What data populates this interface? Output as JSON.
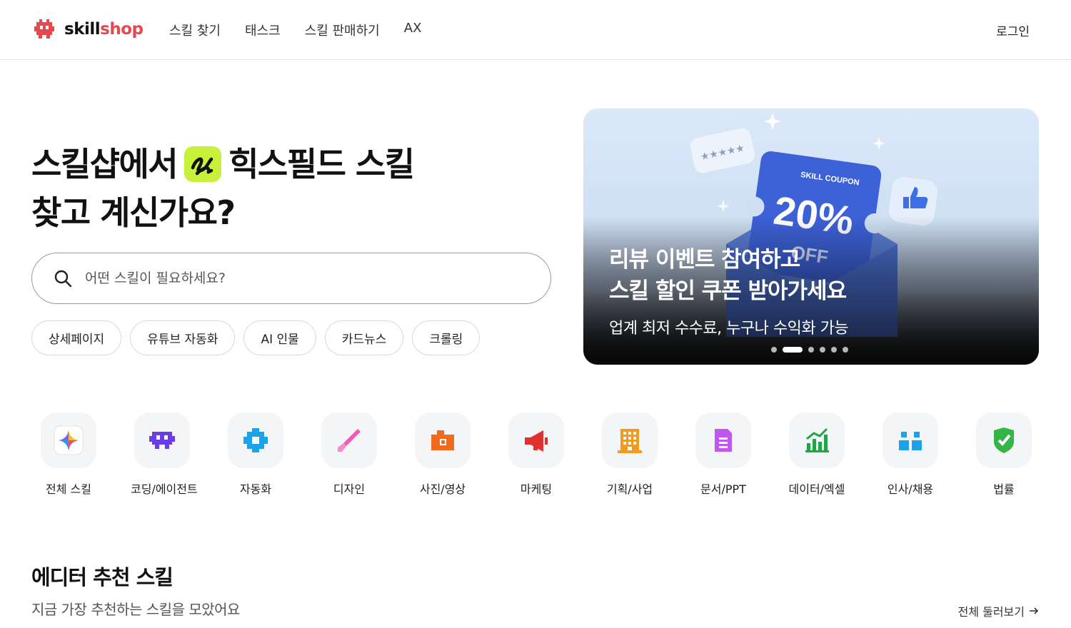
{
  "header": {
    "logo_skill": "skill",
    "logo_shop": "shop",
    "nav": [
      "스킬 찾기",
      "태스크",
      "스킬 판매하기",
      "AX"
    ],
    "login": "로그인"
  },
  "hero": {
    "title_part1": "스킬샵에서",
    "title_part2": "힉스필드 스킬",
    "title_line2": "찾고 계신가요?",
    "search_placeholder": "어떤 스킬이 필요하세요?",
    "chips": [
      "상세페이지",
      "유튜브 자동화",
      "AI 인물",
      "카드뉴스",
      "크롤링"
    ]
  },
  "banner": {
    "coupon_label": "SKILL COUPON",
    "coupon_value": "20%",
    "coupon_off": "OFF",
    "headline_line1": "리뷰 이벤트 참여하고",
    "headline_line2": "스킬 할인 쿠폰 받아가세요",
    "subtext": "업계 최저 수수료, 누구나 수익화 가능",
    "slide_count": 6,
    "active_slide": 2
  },
  "categories": [
    {
      "label": "전체 스킬",
      "icon": "sparkle-icon",
      "color": "#7b61ff"
    },
    {
      "label": "코딩/에이전트",
      "icon": "robot-icon",
      "color": "#6a3de8"
    },
    {
      "label": "자동화",
      "icon": "gear-icon",
      "color": "#1aa3e8"
    },
    {
      "label": "디자인",
      "icon": "brush-icon",
      "color": "#f05bb5"
    },
    {
      "label": "사진/영상",
      "icon": "camera-icon",
      "color": "#f26b1d"
    },
    {
      "label": "마케팅",
      "icon": "megaphone-icon",
      "color": "#e0312f"
    },
    {
      "label": "기획/사업",
      "icon": "building-icon",
      "color": "#f29a1d"
    },
    {
      "label": "문서/PPT",
      "icon": "document-icon",
      "color": "#c257f0"
    },
    {
      "label": "데이터/엑셀",
      "icon": "bar-chart-icon",
      "color": "#22a447"
    },
    {
      "label": "인사/채용",
      "icon": "people-icon",
      "color": "#1aa3e8"
    },
    {
      "label": "법률",
      "icon": "shield-check-icon",
      "color": "#34b546"
    }
  ],
  "section": {
    "title": "에디터 추천 스킬",
    "subtitle": "지금 가장 추천하는 스킬을 모았어요",
    "see_all": "전체 둘러보기"
  }
}
